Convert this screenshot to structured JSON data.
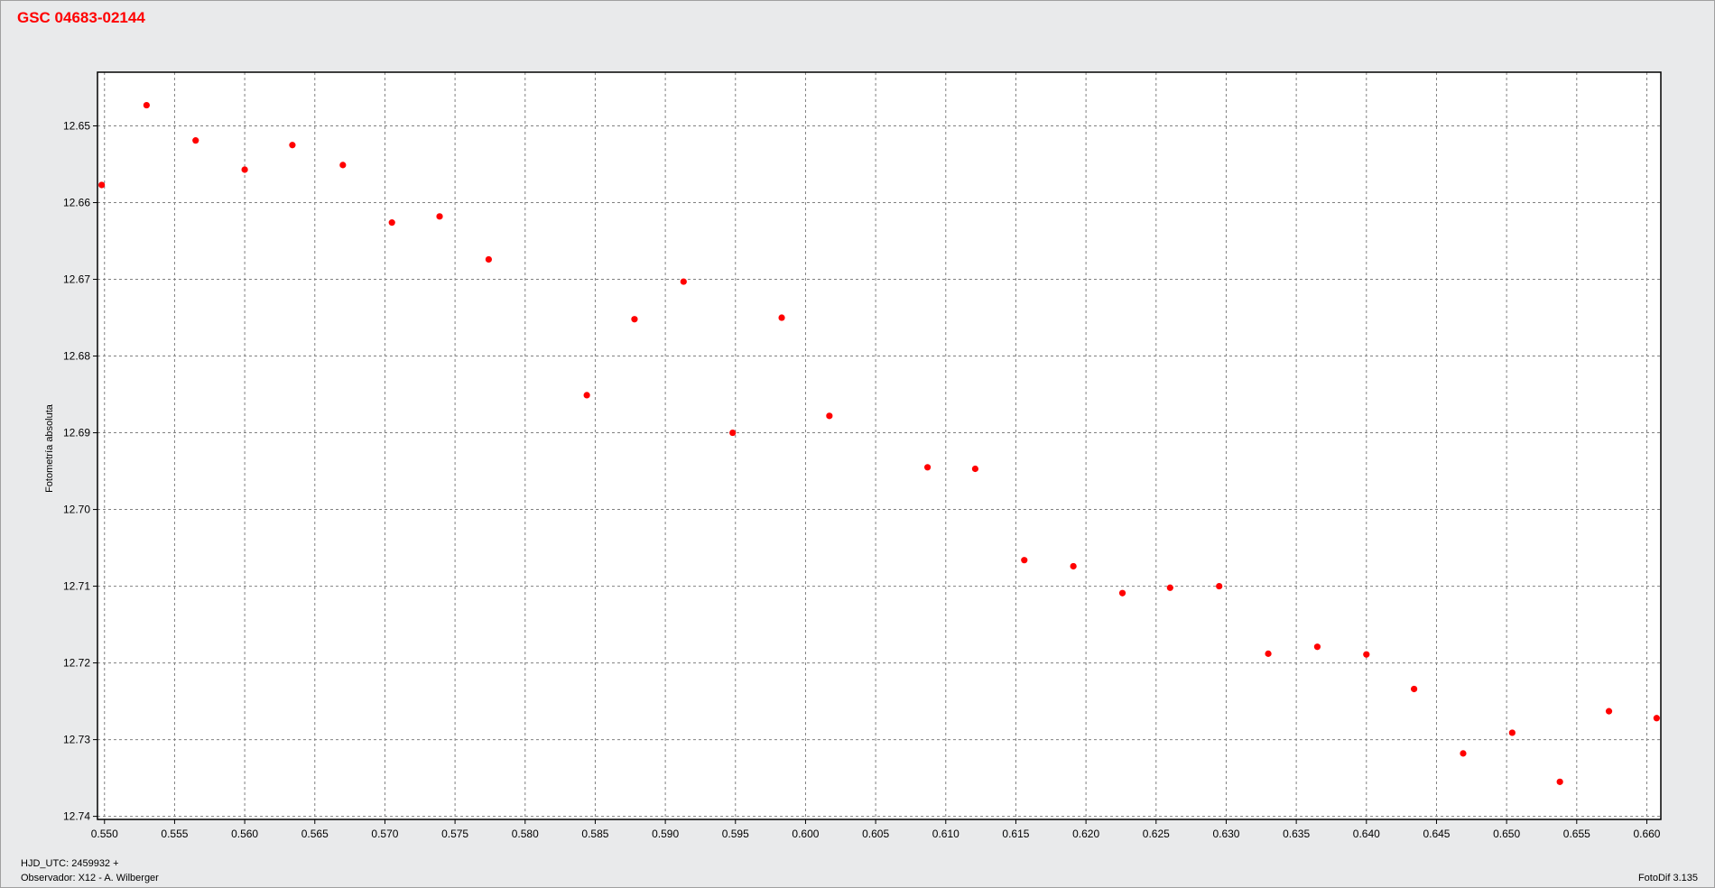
{
  "title": "GSC 04683-02144",
  "footer": {
    "hjd": "HJD_UTC: 2459932 +",
    "observer": "Observador: X12 - A. Wilberger",
    "software": "FotoDif 3.135"
  },
  "colors": {
    "points": "#ff0000",
    "title": "#ff0000",
    "grid": "#808080",
    "background": "#e9eaeb"
  },
  "chart_data": {
    "type": "scatter",
    "title": "GSC 04683-02144",
    "xlabel": "HJD_UTC: 2459932 +",
    "ylabel": "Fotometría absoluta",
    "xlim": [
      0.5495,
      0.661
    ],
    "ylim": [
      12.643,
      12.7404
    ],
    "y_inverted": true,
    "grid": true,
    "legend": "none",
    "xticks": [
      "0.550",
      "0.555",
      "0.560",
      "0.565",
      "0.570",
      "0.575",
      "0.580",
      "0.585",
      "0.590",
      "0.595",
      "0.600",
      "0.605",
      "0.610",
      "0.615",
      "0.620",
      "0.625",
      "0.630",
      "0.635",
      "0.640",
      "0.645",
      "0.650",
      "0.655",
      "0.660"
    ],
    "yticks": [
      "12.65",
      "12.66",
      "12.67",
      "12.68",
      "12.69",
      "12.70",
      "12.71",
      "12.72",
      "12.73",
      "12.74"
    ],
    "series": [
      {
        "x": [
          0.5498,
          0.553,
          0.5565,
          0.56,
          0.5634,
          0.567,
          0.5705,
          0.5739,
          0.5774,
          0.5844,
          0.5878,
          0.5913,
          0.5948,
          0.5983,
          0.6017,
          0.6087,
          0.6121,
          0.6156,
          0.6191,
          0.6226,
          0.626,
          0.6295,
          0.633,
          0.6365,
          0.64,
          0.6434,
          0.6469,
          0.6504,
          0.6538,
          0.6573,
          0.6607
        ],
        "y": [
          12.6577,
          12.6473,
          12.6519,
          12.6557,
          12.6525,
          12.6551,
          12.6626,
          12.6618,
          12.6674,
          12.6851,
          12.6752,
          12.6703,
          12.69,
          12.675,
          12.6878,
          12.6945,
          12.6947,
          12.7066,
          12.7074,
          12.7109,
          12.7102,
          12.71,
          12.7188,
          12.7179,
          12.7189,
          12.7234,
          12.7318,
          12.7291,
          12.7355,
          12.7263,
          12.7272
        ]
      }
    ]
  }
}
